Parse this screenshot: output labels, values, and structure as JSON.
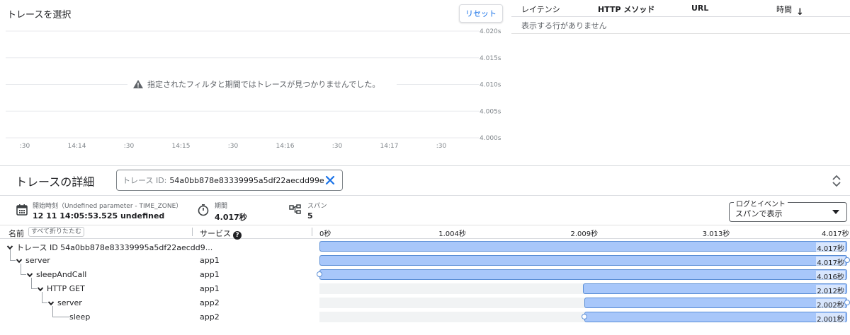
{
  "scatter": {
    "title": "トレースを選択",
    "reset_label": "リセット",
    "empty_message": "指定されたフィルタと期間ではトレースが見つかりませんでした。",
    "y_ticks": [
      "4.020s",
      "4.015s",
      "4.010s",
      "4.005s",
      "4.000s"
    ],
    "x_ticks": [
      ":30",
      "14:14",
      ":30",
      "14:15",
      ":30",
      "14:16",
      ":30",
      "14:17",
      ":30"
    ]
  },
  "table": {
    "headers": [
      "レイテンシ",
      "HTTP メソッド",
      "URL",
      "時間"
    ],
    "empty_text": "表示する行がありません"
  },
  "details": {
    "title": "トレースの詳細",
    "trace_id_label": "トレース ID:",
    "trace_id_value": "54a0bb878e83339995a5df22aecdd99e",
    "start_label": "開始時刻（Undefined parameter - TIME_ZONE）",
    "start_value": "12 11 14:05:53.525 undefined",
    "duration_label": "期間",
    "duration_value": "4.017秒",
    "spans_label": "スパン",
    "spans_value": "5",
    "log_select_legend": "ログとイベント",
    "log_select_value": "スパンで表示"
  },
  "waterfall": {
    "name_header": "名前",
    "collapse_all": "すべて折りたたむ",
    "service_header": "サービス",
    "total_seconds": 4.017,
    "ticks": [
      "0秒",
      "1.004秒",
      "2.009秒",
      "3.013秒",
      "4.017秒"
    ],
    "rows": [
      {
        "name": "トレース ID 54a0bb878e83339995a5df22aecdd9...",
        "service": "",
        "depth": 0,
        "chevron": true,
        "start": 0.0,
        "duration": 4.017,
        "label": "4.017秒",
        "dot": "none"
      },
      {
        "name": "server",
        "service": "app1",
        "depth": 1,
        "chevron": true,
        "start": 0.0,
        "duration": 4.017,
        "label": "4.017秒",
        "dot": "right"
      },
      {
        "name": "sleepAndCall",
        "service": "app1",
        "depth": 2,
        "chevron": true,
        "start": 0.0,
        "duration": 4.016,
        "label": "4.016秒",
        "dot": "left"
      },
      {
        "name": "HTTP GET",
        "service": "app1",
        "depth": 3,
        "chevron": true,
        "start": 2.005,
        "duration": 2.012,
        "label": "2.012秒",
        "dot": "none"
      },
      {
        "name": "server",
        "service": "app2",
        "depth": 4,
        "chevron": true,
        "start": 2.014,
        "duration": 2.002,
        "label": "2.002秒",
        "dot": "right"
      },
      {
        "name": "sleep",
        "service": "app2",
        "depth": 5,
        "chevron": false,
        "start": 2.015,
        "duration": 2.001,
        "label": "2.001秒",
        "dot": "left"
      }
    ]
  },
  "colors": {
    "accent": "#1a73e8",
    "bar_fill": "#a8c7fa",
    "bar_border": "#5b8ed6"
  }
}
